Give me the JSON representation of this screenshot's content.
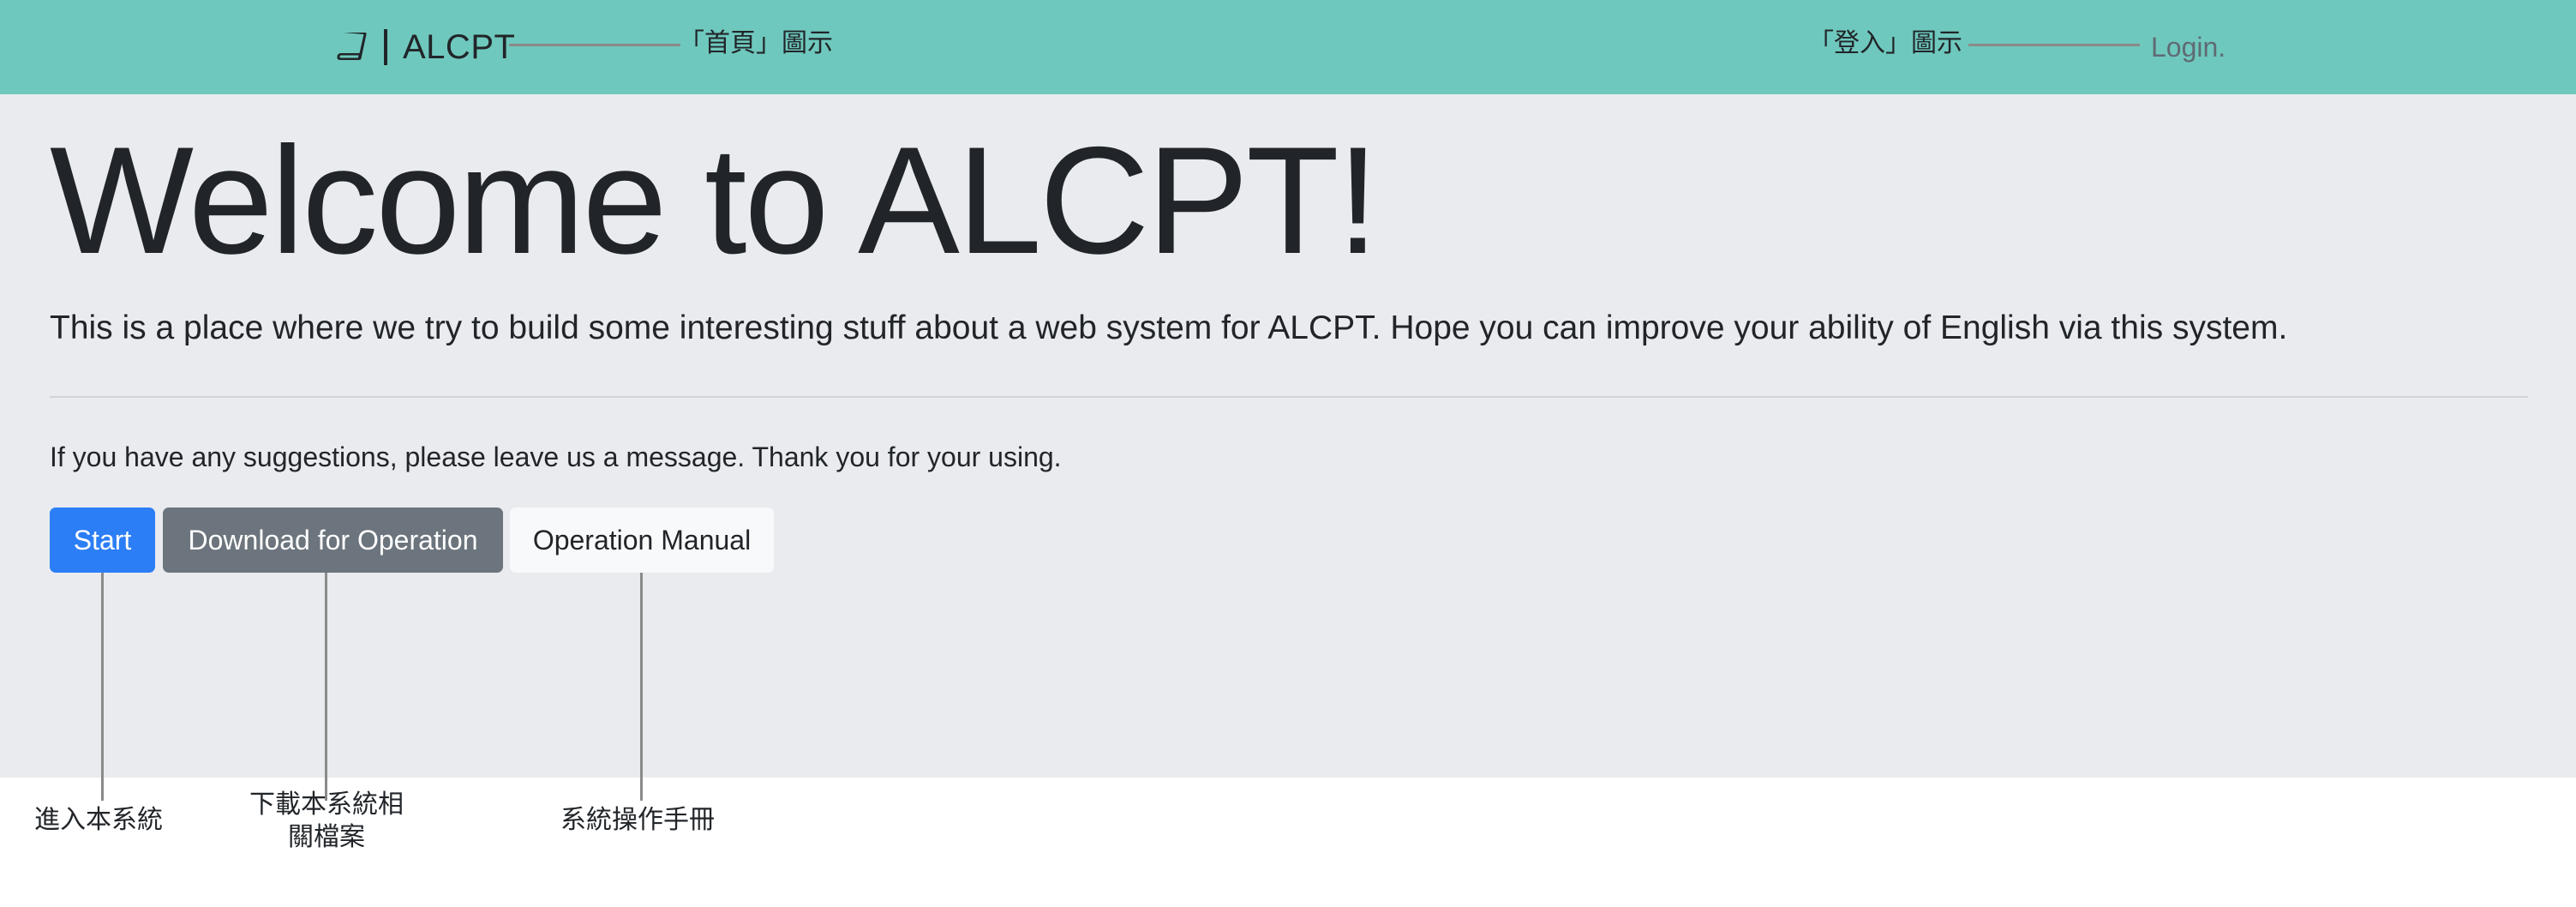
{
  "colors": {
    "navbar_bg": "#6fc8bd",
    "jumbotron_bg": "#e9ebef",
    "primary": "#2b7ef6",
    "secondary": "#6c757d",
    "light": "#f8f9fa",
    "annotation_line": "#8a8a8a"
  },
  "navbar": {
    "brand_icon": "book-icon",
    "brand_text": "ALCPT",
    "login_text": "Login."
  },
  "jumbotron": {
    "title": "Welcome to ALCPT!",
    "lead": "This is a place where we try to build some interesting stuff about a web system for ALCPT. Hope you can improve your ability of English via this system.",
    "suggestion": "If you have any suggestions, please leave us a message. Thank you for your using.",
    "buttons": {
      "start": "Start",
      "download": "Download for Operation",
      "manual": "Operation Manual"
    }
  },
  "annotations": {
    "home_icon": "「首頁」圖示",
    "login_icon": "「登入」圖示",
    "start": "進入本系統",
    "download_line1": "下載本系統相",
    "download_line2": "關檔案",
    "manual": "系統操作手冊"
  }
}
